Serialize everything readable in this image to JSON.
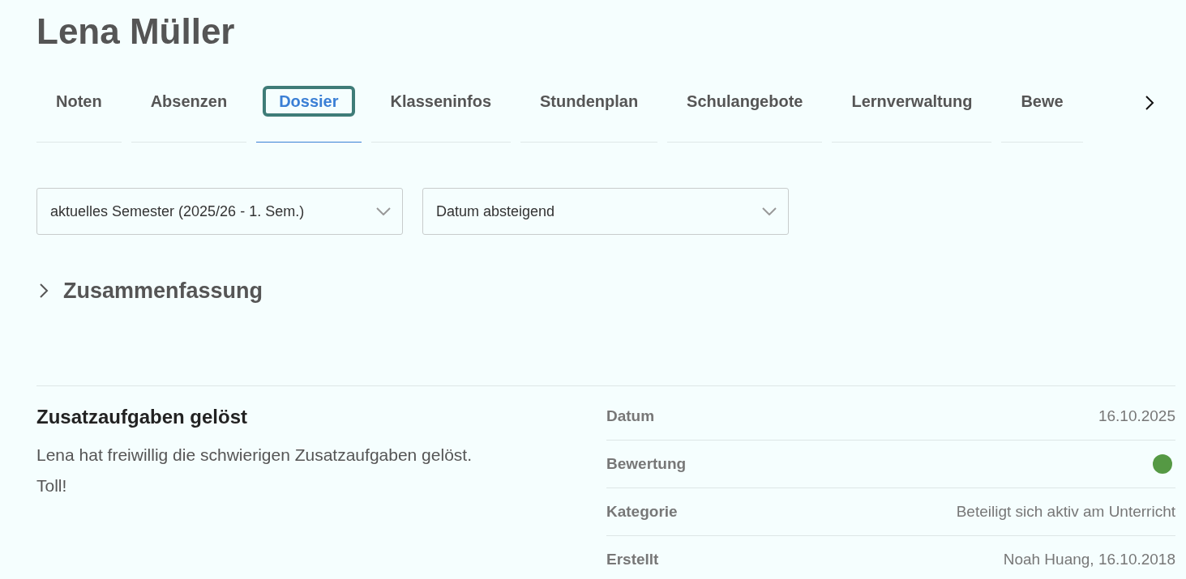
{
  "page": {
    "title": "Lena Müller"
  },
  "tabs": [
    {
      "label": "Noten",
      "selected": false
    },
    {
      "label": "Absenzen",
      "selected": false
    },
    {
      "label": "Dossier",
      "selected": true
    },
    {
      "label": "Klasseninfos",
      "selected": false
    },
    {
      "label": "Stundenplan",
      "selected": false
    },
    {
      "label": "Schulangebote",
      "selected": false
    },
    {
      "label": "Lernverwaltung",
      "selected": false
    },
    {
      "label": "Bewe",
      "selected": false
    }
  ],
  "filters": [
    {
      "value": "aktuelles Semester (2025/26 - 1. Sem.)"
    },
    {
      "value": "Datum absteigend"
    }
  ],
  "summary": {
    "title": "Zusammenfassung",
    "expanded": false
  },
  "entry": {
    "title": "Zusatzaufgaben gelöst",
    "text": "Lena hat freiwillig die schwierigen Zusatzaufgaben gelöst. Toll!",
    "details": [
      {
        "kind": "text",
        "label": "Datum",
        "value": "16.10.2025"
      },
      {
        "kind": "dot",
        "label": "Bewertung",
        "color": "#559944"
      },
      {
        "kind": "text",
        "label": "Kategorie",
        "value": "Beteiligt sich aktiv am Unterricht"
      },
      {
        "kind": "text",
        "label": "Erstellt",
        "value": "Noah Huang, 16.10.2018"
      }
    ]
  }
}
